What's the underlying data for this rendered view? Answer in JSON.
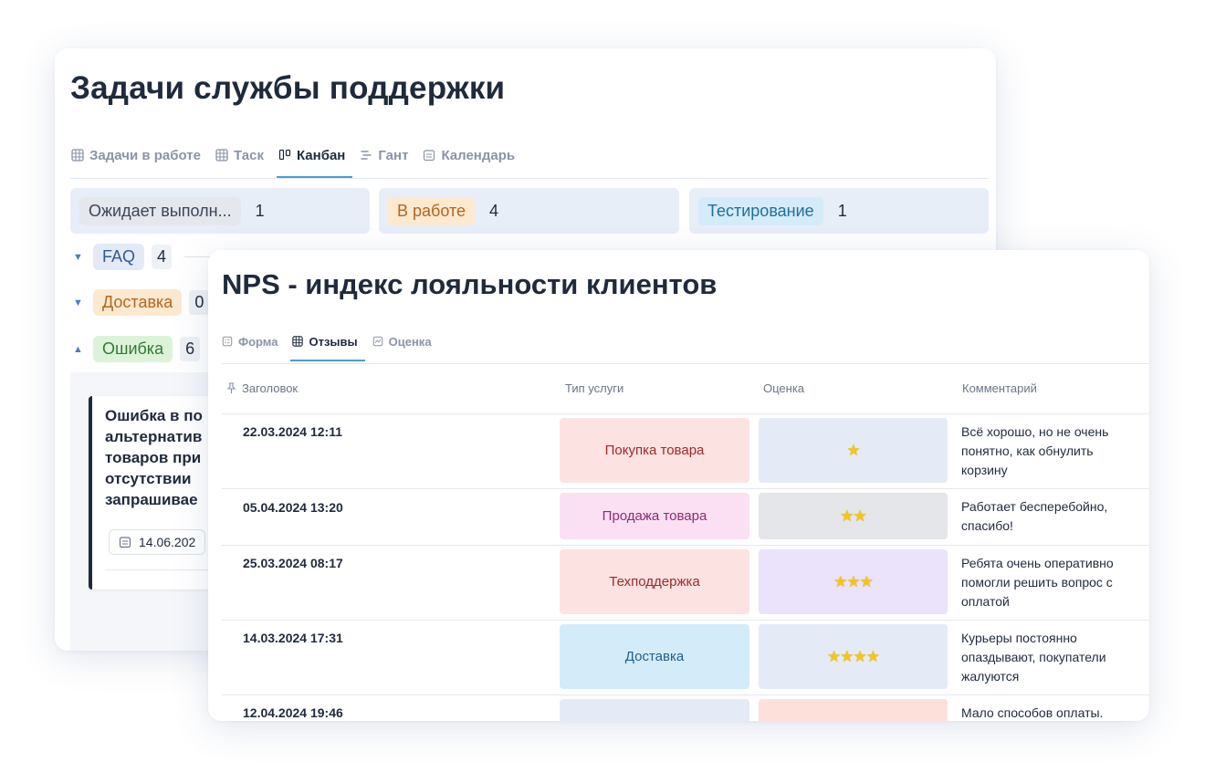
{
  "back": {
    "title": "Задачи службы поддержки",
    "tabs": [
      {
        "label": "Задачи в работе",
        "icon": "table-icon"
      },
      {
        "label": "Таск",
        "icon": "table-icon"
      },
      {
        "label": "Канбан",
        "icon": "kanban-icon",
        "active": true
      },
      {
        "label": "Гант",
        "icon": "gantt-icon"
      },
      {
        "label": "Календарь",
        "icon": "calendar-icon"
      }
    ],
    "columns": [
      {
        "label": "Ожидает выполн...",
        "count": "1",
        "pill_bg": "#e4e7ec",
        "pill_fg": "#3b4558"
      },
      {
        "label": "В работе",
        "count": "4",
        "pill_bg": "#fde9cf",
        "pill_fg": "#b5651d"
      },
      {
        "label": "Тестирование",
        "count": "1",
        "pill_bg": "#d4ecf9",
        "pill_fg": "#1f6f9c"
      }
    ],
    "groups": [
      {
        "label": "FAQ",
        "count": "4",
        "pill_bg": "#e3eaf6",
        "pill_fg": "#2c5c94",
        "expanded": true
      },
      {
        "label": "Доставка",
        "count": "0",
        "pill_bg": "#fde9cf",
        "pill_fg": "#b5651d",
        "expanded": true
      },
      {
        "label": "Ошибка",
        "count": "6",
        "pill_bg": "#dcf3d9",
        "pill_fg": "#2e7d32",
        "expanded": false
      }
    ],
    "task": {
      "lines": [
        "Ошибка в по",
        "альтернатив",
        "товаров при",
        "отсутствии",
        "запрашивае"
      ],
      "date": "14.06.202"
    }
  },
  "front": {
    "title": "NPS - индекс лояльности клиентов",
    "tabs": [
      {
        "label": "Форма",
        "icon": "form-icon"
      },
      {
        "label": "Отзывы",
        "icon": "table-icon",
        "active": true
      },
      {
        "label": "Оценка",
        "icon": "chart-icon"
      }
    ],
    "headers": {
      "title": "Заголовок",
      "service": "Тип услуги",
      "rating": "Оценка",
      "comment": "Комментарий"
    },
    "rows": [
      {
        "date": "22.03.2024 12:11",
        "service": "Покупка товара",
        "svc_bg": "#fde2e2",
        "svc_fg": "#9c2a2a",
        "stars": 1,
        "rate_bg": "#e5ebf6",
        "comment": [
          "Всё хорошо, но не очень",
          "понятно, как обнулить",
          "корзину"
        ]
      },
      {
        "date": "05.04.2024 13:20",
        "service": "Продажа товара",
        "svc_bg": "#fbe0f3",
        "svc_fg": "#8e2a73",
        "stars": 2,
        "rate_bg": "#e4e6ea",
        "comment": [
          "Работает бесперебойно,",
          "спасибо!"
        ]
      },
      {
        "date": "25.03.2024 08:17",
        "service": "Техподдержка",
        "svc_bg": "#fde2e2",
        "svc_fg": "#9c2a2a",
        "stars": 3,
        "rate_bg": "#ebe2fc",
        "comment": [
          "Ребята очень оперативно",
          "помогли решить вопрос с",
          "оплатой"
        ]
      },
      {
        "date": "14.03.2024 17:31",
        "service": "Доставка",
        "svc_bg": "#d4ecf9",
        "svc_fg": "#1f5f8a",
        "stars": 4,
        "rate_bg": "#e5ebf6",
        "comment": [
          "Курьеры постоянно",
          "опаздывают, покупатели",
          "жалуются"
        ]
      },
      {
        "date": "12.04.2024 19:46",
        "service": "",
        "svc_bg": "#e5ebf6",
        "svc_fg": "#1f2a3c",
        "stars": 0,
        "rate_bg": "#fde0da",
        "comment": [
          "Мало способов оплаты."
        ]
      }
    ]
  }
}
